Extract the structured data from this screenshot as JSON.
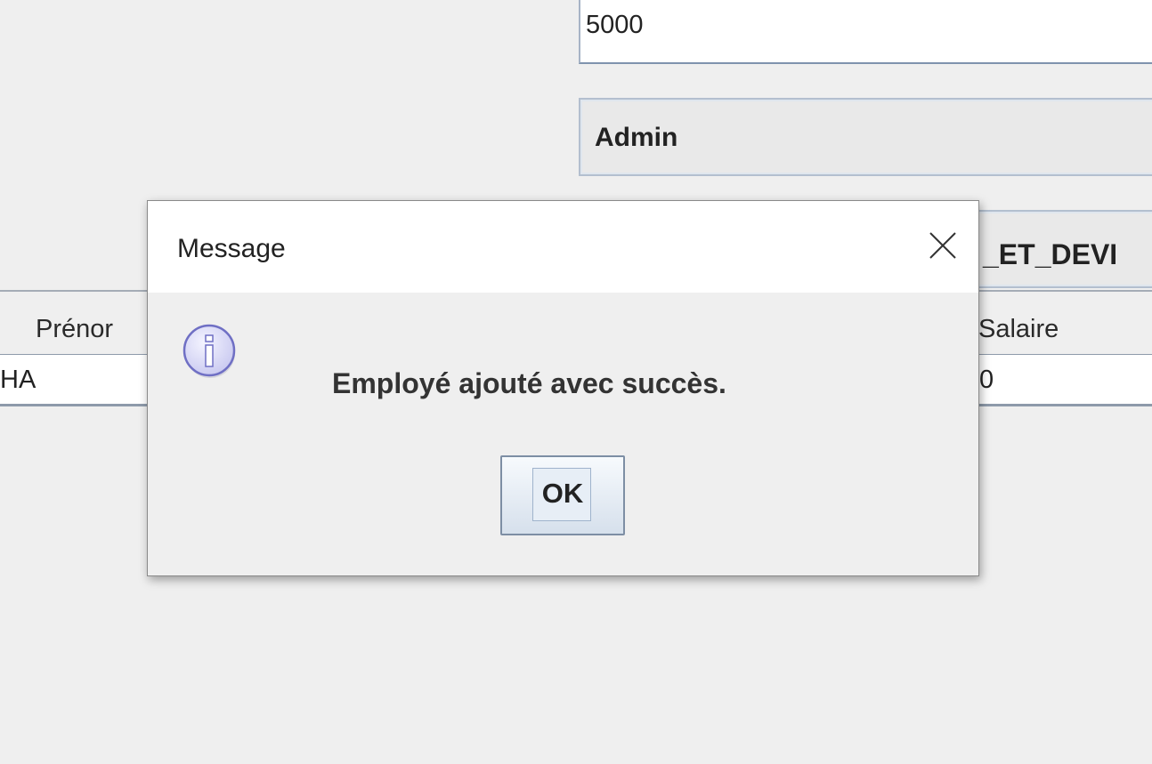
{
  "background": {
    "salary_value": "5000",
    "role_value": "Admin",
    "department_value": "_ET_DEVI",
    "table": {
      "headers": [
        "Prénor",
        "Salaire"
      ],
      "row": [
        "HA",
        "0"
      ]
    }
  },
  "dialog": {
    "title": "Message",
    "message": "Employé ajouté avec succès.",
    "ok_label": "OK",
    "icons": {
      "close": "close-icon",
      "info": "information-icon"
    }
  },
  "colors": {
    "window_bg": "#efefef",
    "title_bar": "#ffffff",
    "info_icon_fill": "#d9d9f7",
    "info_icon_stroke": "#6f6fc4",
    "button_border": "#7d8ea4"
  }
}
